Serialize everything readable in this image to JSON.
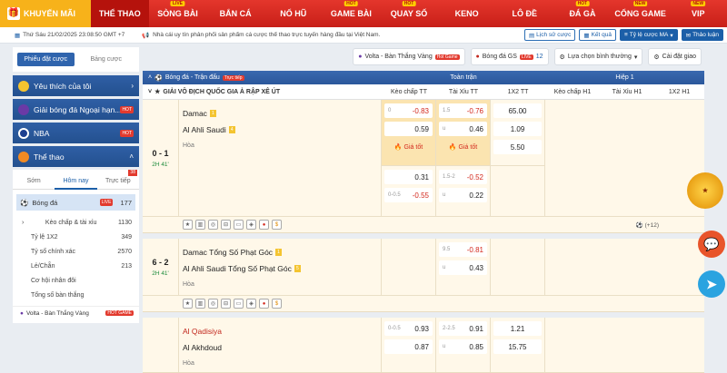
{
  "nav": {
    "promo": "KHUYẾN MÃI",
    "items": [
      {
        "label": "THỂ THAO",
        "tag": "",
        "active": true
      },
      {
        "label": "SÒNG BÀI",
        "tag": "LIVE"
      },
      {
        "label": "BẮN CÁ",
        "tag": ""
      },
      {
        "label": "NỔ HŨ",
        "tag": ""
      },
      {
        "label": "GAME BÀI",
        "tag": "HOT"
      },
      {
        "label": "QUAY SỐ",
        "tag": "HOT"
      },
      {
        "label": "KENO",
        "tag": ""
      },
      {
        "label": "LÔ ĐỀ",
        "tag": ""
      },
      {
        "label": "ĐÁ GÀ",
        "tag": "HOT"
      },
      {
        "label": "CỔNG GAME",
        "tag": "NEW"
      },
      {
        "label": "VIP",
        "tag": "NEW"
      }
    ]
  },
  "topbar": {
    "datetime": "Thứ Sáu 21/02/2025 23:08:50 GMT +7",
    "marquee": "Nhà cái uy tín phân phối sản phẩm cá cược thể thao trực tuyến hàng đầu tại Việt Nam.",
    "buttons": [
      "Lịch sử cược",
      "Kết quả",
      "Tỷ lệ cược MA",
      "Thảo luận"
    ]
  },
  "sidebar": {
    "tab_active": "Phiếu đặt cược",
    "tab_other": "Bảng cược",
    "items": [
      {
        "label": "Yêu thích của tôi",
        "badge": ""
      },
      {
        "label": "Giải bóng đá Ngoại hạn...",
        "badge": "HOT"
      },
      {
        "label": "NBA",
        "badge": "HOT"
      },
      {
        "label": "Thể thao",
        "badge": ""
      }
    ],
    "sport_tabs": [
      "Sớm",
      "Hôm nay",
      "Trực tiếp"
    ],
    "live_count": "38",
    "soccer_label": "Bóng đá",
    "soccer_live": "LIVE",
    "soccer_count": "177",
    "markets": [
      {
        "label": "Kèo chấp & tài xỉu",
        "count": "1130"
      },
      {
        "label": "Tỷ lệ 1X2",
        "count": "349"
      },
      {
        "label": "Tỷ số chính xác",
        "count": "2570"
      },
      {
        "label": "Lẻ/Chẵn",
        "count": "213"
      },
      {
        "label": "Cơ hội nhân đôi",
        "count": ""
      },
      {
        "label": "Tổng số bàn thắng",
        "count": ""
      }
    ],
    "volta": "Volta - Bàn Thắng Vàng",
    "volta_badge": "HOT GAME"
  },
  "controls": {
    "volta": "Volta - Bàn Thắng Vàng",
    "volta_badge": "Hot Game",
    "gs_label": "Bóng đá GS",
    "gs_badge": "LIVE",
    "gs_count": "12",
    "filter": "Lựa chọn bình thường",
    "settings": "Cài đặt giao"
  },
  "table": {
    "sport": "Bóng đá - Trận đấu",
    "live_tag": "Trực tiếp",
    "fulltime": "Toàn trận",
    "half1": "Hiệp 1",
    "league": "GIẢI VÔ ĐỊCH QUỐC GIA Ả RẬP XÊ ÚT",
    "cols": [
      "Kèo chấp TT",
      "Tài Xỉu TT",
      "1X2 TT",
      "Kèo chấp H1",
      "Tài Xỉu H1",
      "1X2 H1"
    ],
    "good_price": "Giá tốt",
    "more": "(+12)"
  },
  "matches": [
    {
      "score": "0 - 1",
      "time": "2H 41'",
      "home": "Damac",
      "home_card": "1",
      "away": "Al Ahli Saudi",
      "away_card": "4",
      "draw": "Hòa",
      "r1": {
        "hc_h": "0",
        "hc_v": "-0.83",
        "hc_v2": "0.59",
        "ou_h": "1.5",
        "ou_v": "-0.76",
        "ou_h2": "u",
        "ou_v2": "0.46",
        "x1": "65.00",
        "x2": "1.09",
        "x3": "5.50"
      },
      "r2": {
        "hc_v": "0.31",
        "hc_h2": "0-0.5",
        "hc_v2": "-0.55",
        "ou_h": "1.5-2",
        "ou_v": "-0.52",
        "ou_h2": "u",
        "ou_v2": "0.22"
      }
    },
    {
      "score": "6 - 2",
      "time": "2H 41'",
      "home": "Damac Tổng Số Phạt Góc",
      "home_card": "1",
      "away": "Al Ahli Saudi Tổng Số Phạt Góc",
      "away_card": "5",
      "draw": "Hòa",
      "r1": {
        "ou_h": "9.5",
        "ou_v": "-0.81",
        "ou_h2": "u",
        "ou_v2": "0.43"
      }
    },
    {
      "home": "Al Qadisiya",
      "away": "Al Akhdoud",
      "draw": "Hòa",
      "r1": {
        "hc_h": "0-0.5",
        "hc_v": "0.93",
        "hc_v2": "0.87",
        "ou_h": "2-2.5",
        "ou_v": "0.91",
        "ou_h2": "u",
        "ou_v2": "0.85",
        "x1": "1.21",
        "x2": "15.75"
      }
    }
  ],
  "colors": {
    "nav_red": "#d6211a",
    "promo": "#f7b21a",
    "blue": "#2f5fa5",
    "odds_hl": "#fbe4b0",
    "neg": "#d3281c"
  }
}
